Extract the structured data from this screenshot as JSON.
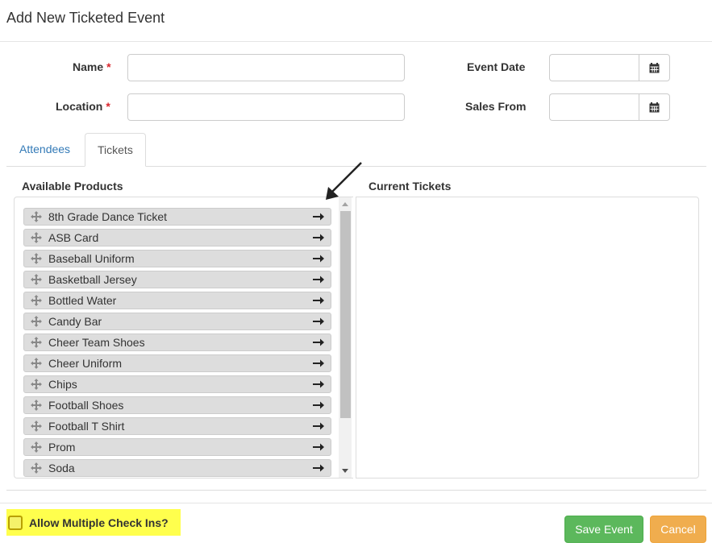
{
  "modal": {
    "title": "Add New Ticketed Event"
  },
  "form": {
    "name_label": "Name",
    "location_label": "Location",
    "required_mark": "*",
    "name_value": "",
    "location_value": "",
    "event_date_label": "Event Date",
    "sales_from_label": "Sales From",
    "event_date_value": "",
    "sales_from_value": "",
    "calendar_icon": "calendar-icon"
  },
  "tabs": [
    {
      "label": "Attendees",
      "active": false
    },
    {
      "label": "Tickets",
      "active": true
    }
  ],
  "tickets": {
    "available_label": "Available Products",
    "current_label": "Current Tickets",
    "products": [
      "8th Grade Dance Ticket",
      "ASB Card",
      "Baseball Uniform",
      "Basketball Jersey",
      "Bottled Water",
      "Candy Bar",
      "Cheer Team Shoes",
      "Cheer Uniform",
      "Chips",
      "Football Shoes",
      "Football T Shirt",
      "Prom",
      "Soda"
    ],
    "current_tickets": [],
    "move_icon": "move-icon",
    "add_icon": "arrow-right-icon"
  },
  "footer": {
    "allow_multiple_label": "Allow Multiple Check Ins?",
    "allow_multiple_checked": false,
    "save_label": "Save Event",
    "cancel_label": "Cancel"
  },
  "colors": {
    "highlight": "#ffff4d",
    "save": "#5cb85c",
    "cancel": "#f0ad4e",
    "link": "#337ab7",
    "required": "#d9262d"
  }
}
